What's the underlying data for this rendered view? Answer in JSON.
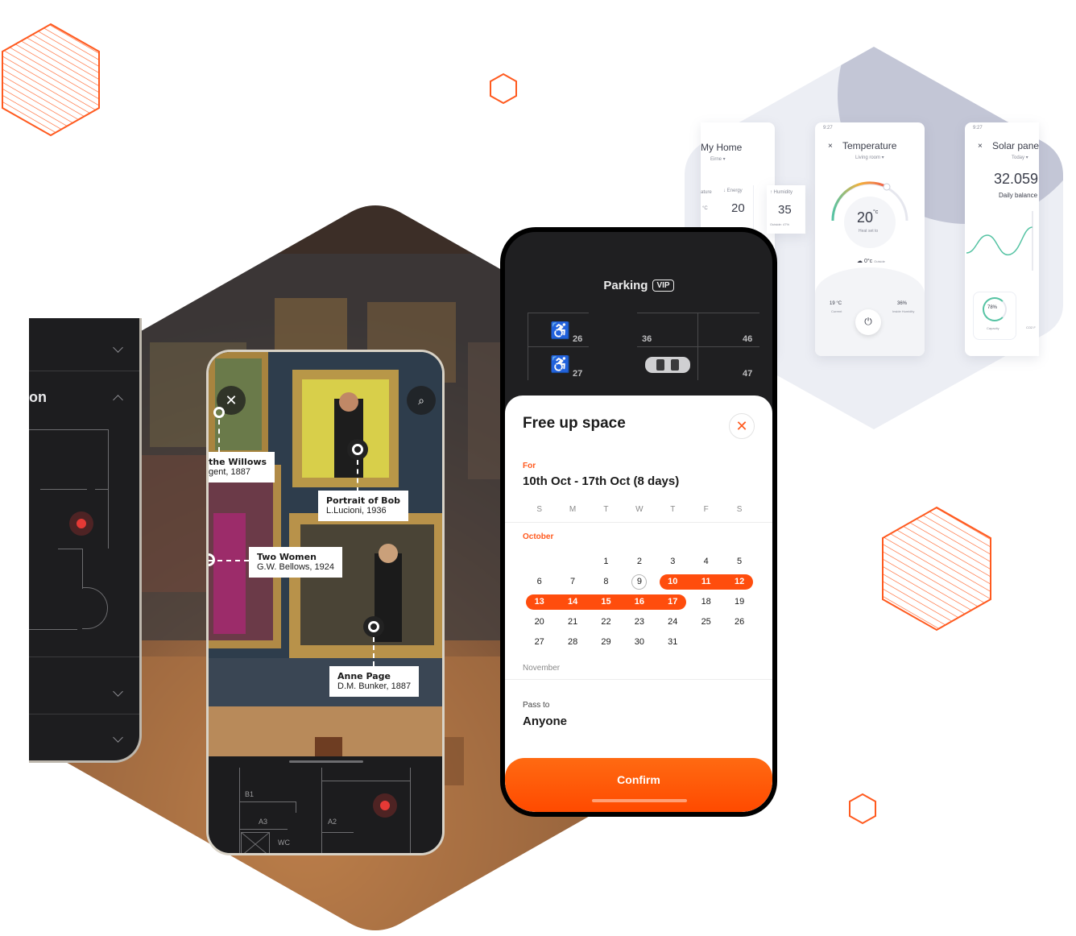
{
  "museum_app": {
    "left_phone": {
      "section_label": "on"
    },
    "ar_labels": [
      {
        "title": "the Willows",
        "subtitle": "gent, 1887"
      },
      {
        "title": "Portrait of Bob",
        "subtitle": "L.Lucioni, 1936"
      },
      {
        "title": "Two Women",
        "subtitle": "G.W. Bellows, 1924"
      },
      {
        "title": "Anne Page",
        "subtitle": "D.M. Bunker, 1887"
      }
    ],
    "floor_map_labels": [
      "B1",
      "A3",
      "A2",
      "WC"
    ]
  },
  "parking_app": {
    "title": "Parking",
    "badge": "VIP",
    "slots": [
      "26",
      "27",
      "36",
      "46",
      "47"
    ],
    "sheet": {
      "title": "Free up space",
      "for_label": "For",
      "date_range": "10th Oct - 17th Oct (8 days)",
      "weekdays": [
        "S",
        "M",
        "T",
        "W",
        "T",
        "F",
        "S"
      ],
      "month_current": "October",
      "month_next": "November",
      "weeks": [
        [
          "",
          "",
          "1",
          "2",
          "3",
          "4",
          "5"
        ],
        [
          "6",
          "7",
          "8",
          "9",
          "10",
          "11",
          "12"
        ],
        [
          "13",
          "14",
          "15",
          "16",
          "17",
          "18",
          "19"
        ],
        [
          "20",
          "21",
          "22",
          "23",
          "24",
          "25",
          "26"
        ],
        [
          "27",
          "28",
          "29",
          "30",
          "31",
          "",
          ""
        ]
      ],
      "today": "9",
      "selected_start": "10",
      "selected_end": "17",
      "pass_to_label": "Pass to",
      "pass_to_value": "Anyone",
      "confirm_label": "Confirm"
    }
  },
  "smart_home_app": {
    "my_home": {
      "title": "My Home",
      "subtitle": "Eirne ▾",
      "tiles": [
        {
          "label": "ature",
          "value": "°C"
        },
        {
          "label": "↓ Energy",
          "value": "20",
          "unit": "kWh"
        },
        {
          "label": "↑ Humidity",
          "value": "35",
          "note": "Outside: 47%"
        }
      ]
    },
    "temperature": {
      "time": "9:27",
      "title": "Temperature",
      "subtitle": "Living room ▾",
      "value": "20",
      "unit": "°c",
      "caption": "Heat set to",
      "outside": "0°c",
      "outside_label": "Outside",
      "current": "19 °C",
      "current_label": "Current",
      "humidity": "36%",
      "humidity_label": "Inside Humidity",
      "gauge_fraction": 0.62
    },
    "solar": {
      "time": "9:27",
      "title": "Solar pane",
      "subtitle": "Today ▾",
      "value": "32.059",
      "caption": "Daily balance",
      "capacity": "78%",
      "capacity_label": "Capacity",
      "co2_label": "CO2 F"
    }
  },
  "colors": {
    "accent": "#ff4d0d",
    "dark": "#1f1f21",
    "hex_light": "#eaebf1",
    "hex_mid": "#c7cad8"
  }
}
